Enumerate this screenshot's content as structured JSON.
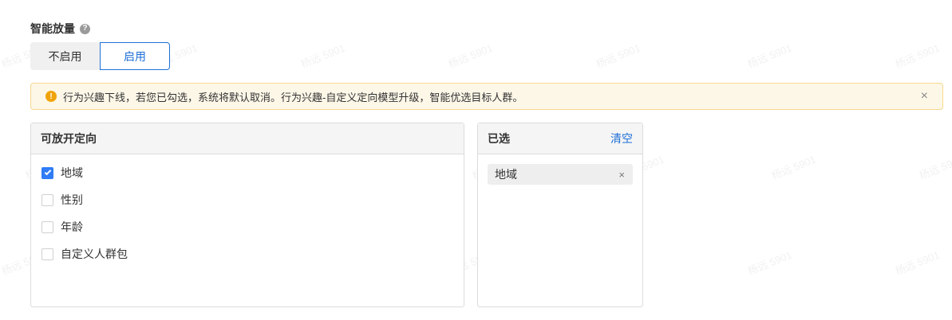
{
  "section": {
    "title": "智能放量",
    "help_icon": "question-circle-icon"
  },
  "toggle": {
    "off_label": "不启用",
    "on_label": "启用",
    "selected": "启用"
  },
  "alert": {
    "icon": "warning-circle-icon",
    "text": "行为兴趣下线，若您已勾选，系统将默认取消。行为兴趣-自定义定向模型升级，智能优选目标人群。",
    "close_icon": "close-icon"
  },
  "available": {
    "title": "可放开定向",
    "options": [
      {
        "label": "地域",
        "checked": true
      },
      {
        "label": "性别",
        "checked": false
      },
      {
        "label": "年龄",
        "checked": false
      },
      {
        "label": "自定义人群包",
        "checked": false
      }
    ]
  },
  "selected": {
    "title": "已选",
    "clear_label": "清空",
    "tags": [
      {
        "label": "地域"
      }
    ]
  },
  "watermark": {
    "text": "杨远 5901"
  },
  "colors": {
    "accent": "#1f6fd6",
    "checkbox_checked": "#2f7cf6",
    "alert_bg": "#fdf7e8",
    "alert_border": "#f6d98f",
    "warning": "#f0a30a"
  }
}
